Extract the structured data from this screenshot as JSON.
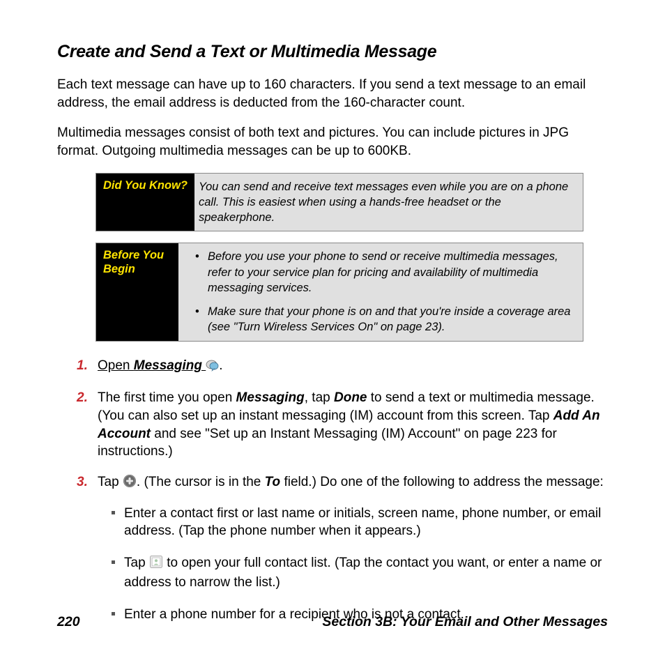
{
  "heading": "Create and Send a Text or Multimedia Message",
  "para1": "Each text message can have up to 160 characters. If you send a text message to an email address, the email address is deducted from the 160-character count.",
  "para2": "Multimedia messages consist of both text and pictures. You can include pictures in JPG format. Outgoing multimedia messages can be up to 600KB.",
  "callout1": {
    "label": "Did You Know?",
    "body": "You can send and receive text messages even while you are on a phone call. This is easiest when using a hands-free headset or the speakerphone."
  },
  "callout2": {
    "label": "Before You Begin",
    "item1": "Before you use your phone to send or receive multimedia messages, refer to your service plan for pricing and availability of multimedia messaging services.",
    "item2": "Make sure that your phone is on and that you're inside a coverage area (see \"Turn Wireless Services On\" on page 23)."
  },
  "step1": {
    "open": "Open",
    "app": "Messaging",
    "period": "."
  },
  "step2": {
    "t1": "The first time you open ",
    "b1": "Messaging",
    "t2": ", tap ",
    "b2": "Done",
    "t3": " to send a text or multimedia message. (You can also set up an instant messaging (IM) account from this screen. Tap ",
    "b3": "Add An Account",
    "t4": " and see \"Set up an Instant Messaging (IM) Account\" on page 223 for instructions.)"
  },
  "step3": {
    "t1": "Tap ",
    "t2": ". (The cursor is in the ",
    "b1": "To",
    "t3": " field.) Do one of the following to address the message:",
    "sub1": "Enter a contact first or last name or initials, screen name, phone number, or email address. (Tap the phone number when it appears.)",
    "sub2a": "Tap ",
    "sub2b": " to open your full contact list. (Tap the contact you want, or enter a name or address to narrow the list.)",
    "sub3": "Enter a phone number for a recipient who is not a contact."
  },
  "footer": {
    "pagenum": "220",
    "section": "Section 3B: Your Email and Other Messages"
  }
}
